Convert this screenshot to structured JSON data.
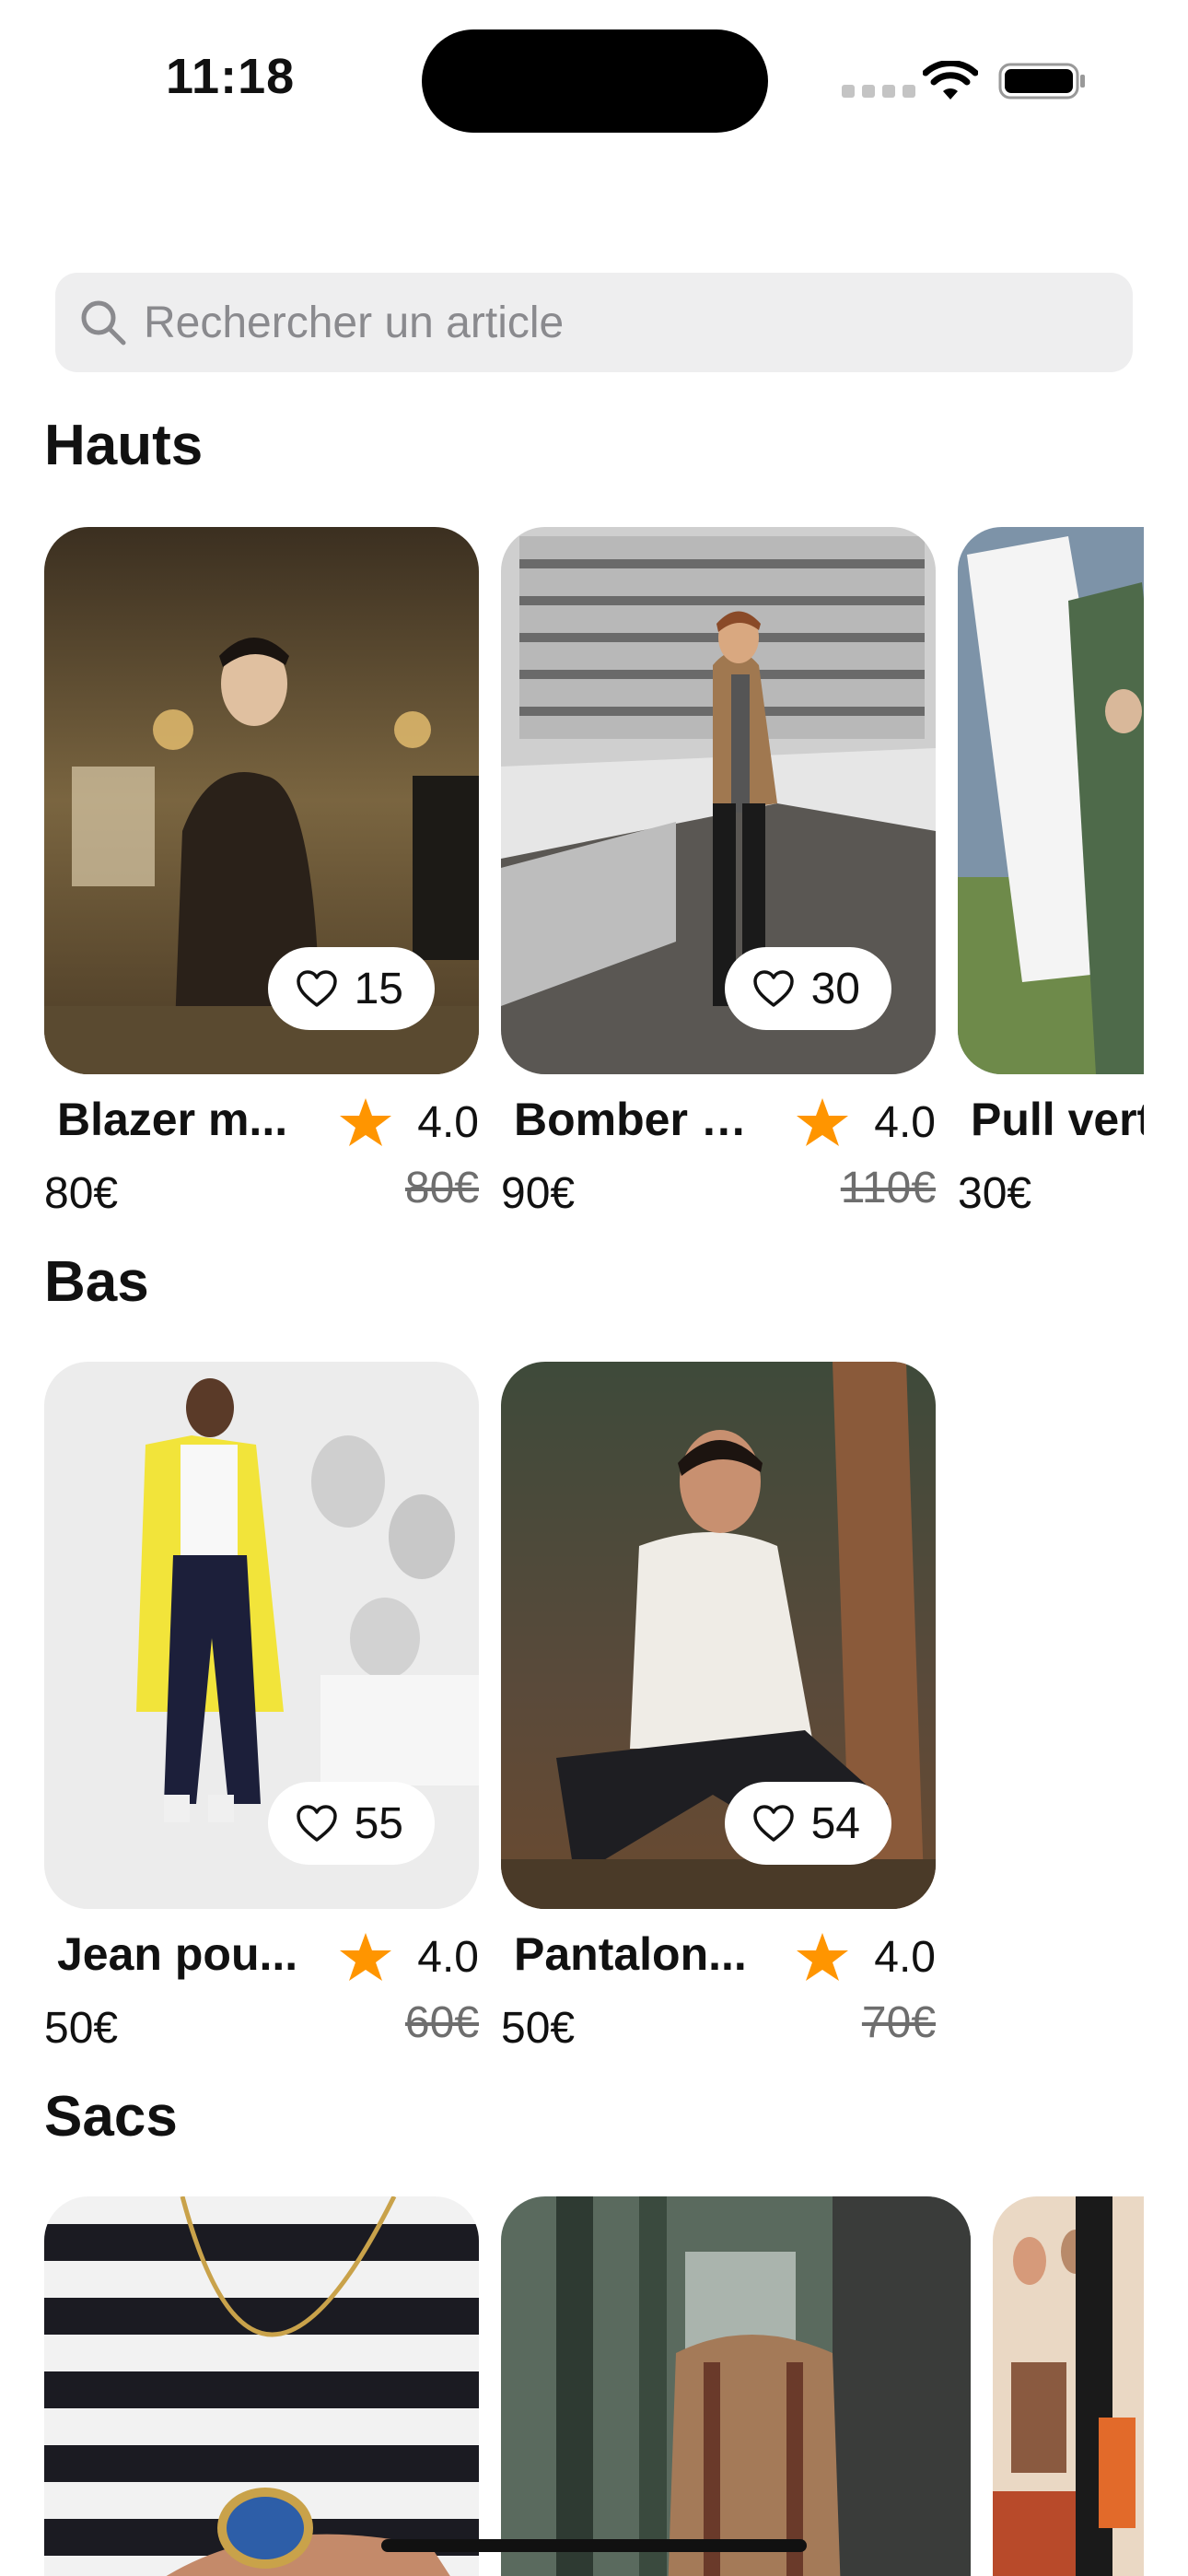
{
  "status": {
    "time": "11:18"
  },
  "search": {
    "placeholder": "Rechercher un article"
  },
  "sections": [
    {
      "title": "Hauts",
      "items": [
        {
          "name": "Blazer m...",
          "price": "80€",
          "old_price": "80€",
          "rating": "4.0",
          "likes": "15"
        },
        {
          "name": "Bomber a...",
          "price": "90€",
          "old_price": "110€",
          "rating": "4.0",
          "likes": "30"
        },
        {
          "name": "Pull vert",
          "price": "30€"
        }
      ]
    },
    {
      "title": "Bas",
      "items": [
        {
          "name": "Jean pou...",
          "price": "50€",
          "old_price": "60€",
          "rating": "4.0",
          "likes": "55"
        },
        {
          "name": "Pantalon...",
          "price": "50€",
          "old_price": "70€",
          "rating": "4.0",
          "likes": "54"
        }
      ]
    },
    {
      "title": "Sacs",
      "items": [
        {
          "image": "pendant-necklace-photo"
        },
        {
          "image": "leather-backpack-photo"
        },
        {
          "image": "shop-display-photo"
        }
      ]
    }
  ],
  "icons": {
    "search": "search-icon",
    "like": "heart-icon",
    "rating": "star-icon"
  },
  "colors": {
    "star": "#FF9500",
    "search_bg": "#EEEEEF",
    "placeholder": "#8A8A8E"
  }
}
